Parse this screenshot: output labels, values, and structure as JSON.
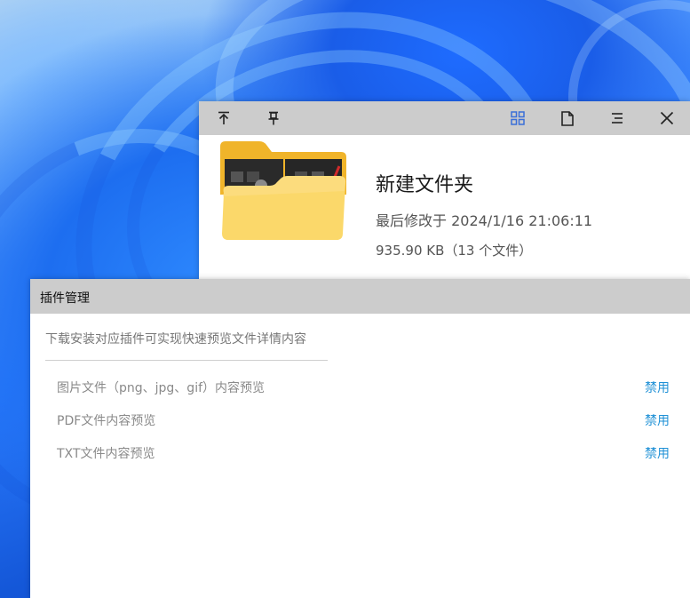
{
  "preview": {
    "toolbar": {
      "to_top_icon": "arrow-up-to-line-icon",
      "pin_icon": "pin-icon",
      "grid_icon": "grid-icon",
      "file_icon": "file-icon",
      "menu_icon": "menu-icon",
      "close_icon": "close-icon"
    },
    "file_name": "新建文件夹",
    "modified": "最后修改于 2024/1/16 21:06:11",
    "size": "935.90 KB（13 个文件）"
  },
  "plugin_manager": {
    "title": "插件管理",
    "description": "下载安装对应插件可实现快速预览文件详情内容",
    "plugins": [
      {
        "label": "图片文件（png、jpg、gif）内容预览",
        "action": "禁用"
      },
      {
        "label": "PDF文件内容预览",
        "action": "禁用"
      },
      {
        "label": "TXT文件内容预览",
        "action": "禁用"
      }
    ]
  },
  "colors": {
    "titlebar": "#cccccc",
    "accent_link": "#1e90d6",
    "grid_icon": "#3a6fd8",
    "folder_yellow": "#f7c646"
  }
}
